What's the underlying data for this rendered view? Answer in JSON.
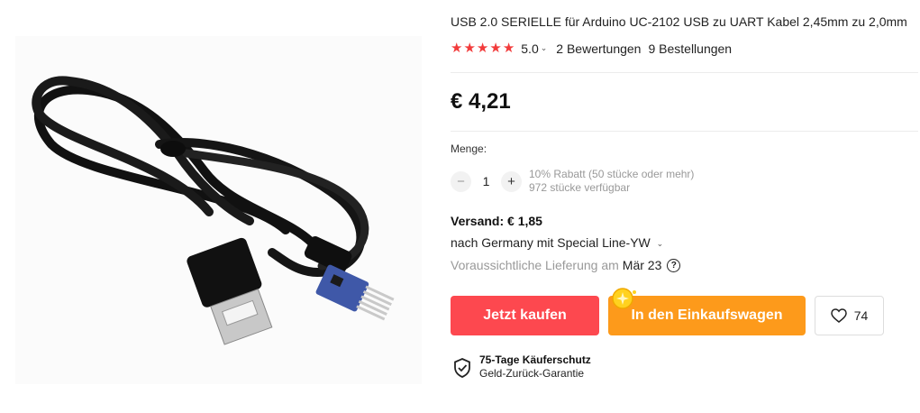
{
  "product": {
    "title": "USB 2.0 SERIELLE für Arduino UC-2102 USB zu UART Kabel 2,45mm zu 2,0mm",
    "rating": "5.0",
    "reviews": "2 Bewertungen",
    "orders": "9 Bestellungen",
    "price": "€ 4,21",
    "image_icon": "usb-uart-cable-photo"
  },
  "quantity": {
    "label": "Menge:",
    "value": "1",
    "minus": "−",
    "plus": "+",
    "discount": "10% Rabatt (50 stücke oder mehr)",
    "available": "972 stücke verfügbar"
  },
  "shipping": {
    "title": "Versand: € 1,85",
    "method": "nach Germany mit Special Line-YW",
    "delivery_label": "Voraussichtliche Lieferung am",
    "delivery_date": "Mär 23"
  },
  "actions": {
    "buy_now": "Jetzt kaufen",
    "add_to_cart": "In den Einkaufswagen",
    "wishlist_count": "74"
  },
  "protection": {
    "title": "75-Tage Käuferschutz",
    "subtitle": "Geld-Zurück-Garantie"
  },
  "colors": {
    "star": "#f23b3b",
    "buy_button": "#fd484f",
    "cart_button": "#fd9a1b"
  }
}
